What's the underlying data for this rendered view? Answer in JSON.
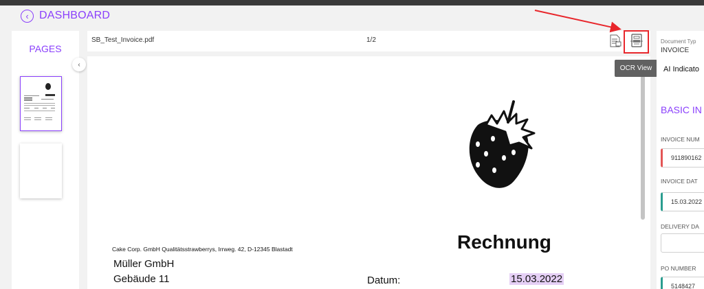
{
  "header": {
    "title": "DASHBOARD",
    "back_icon": "chevron-left-circle-icon"
  },
  "pages_panel": {
    "title": "PAGES",
    "collapse_icon": "chevron-left-icon"
  },
  "toolbar": {
    "filename": "SB_Test_Invoice.pdf",
    "page_count": "1/2",
    "doc_icon": "document-lines-icon",
    "ocr_icon": "ocr-scan-icon",
    "ocr_tooltip": "OCR View"
  },
  "document": {
    "sender_line": "Cake Corp. GmbH Qualitätsstrawberrys, Irrweg. 42, D-12345 Blastadt",
    "recipient_name": "Müller GmbH",
    "recipient_address": "Gebäude 11",
    "heading": "Rechnung",
    "date_label": "Datum:",
    "date_value": "15.03.2022",
    "logo_icon": "strawberry-icon"
  },
  "right_panel": {
    "doc_type_label": "Document Typ",
    "doc_type_value": "INVOICE",
    "ai_indicator": "AI Indicato",
    "section_title": "BASIC IN",
    "fields": [
      {
        "label": "INVOICE NUM",
        "value": "911890162"
      },
      {
        "label": "INVOICE DAT",
        "value": "15.03.2022"
      },
      {
        "label": "DELIVERY DA",
        "value": ""
      },
      {
        "label": "PO NUMBER",
        "value": "5148427"
      }
    ]
  },
  "colors": {
    "accent": "#8a3ffc",
    "highlight_box": "#e8262b",
    "invalid": "#e35555",
    "valid": "#2a9d8f"
  }
}
